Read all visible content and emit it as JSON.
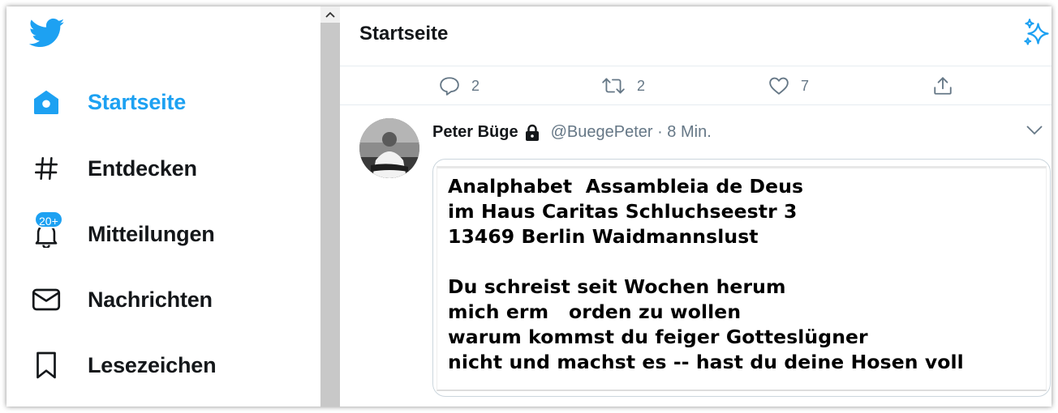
{
  "sidebar": {
    "items": [
      {
        "label": "Startseite",
        "icon": "home-icon",
        "active": true
      },
      {
        "label": "Entdecken",
        "icon": "hashtag-icon"
      },
      {
        "label": "Mitteilungen",
        "icon": "bell-icon",
        "badge": "20+"
      },
      {
        "label": "Nachrichten",
        "icon": "envelope-icon"
      },
      {
        "label": "Lesezeichen",
        "icon": "bookmark-icon"
      }
    ]
  },
  "header": {
    "title": "Startseite"
  },
  "prev_tweet_actions": {
    "reply_count": "2",
    "retweet_count": "2",
    "like_count": "7"
  },
  "tweet": {
    "author": "Peter Büge",
    "handle": "@BuegePeter · 8 Min.",
    "media_lines": [
      "Analphabet  Assambleia de Deus",
      "im Haus Caritas Schluchseestr 3",
      "13469 Berlin Waidmannslust",
      "",
      "Du schreist seit Wochen herum",
      "mich erm   orden zu wollen",
      "warum kommst du feiger Gotteslügner",
      "nicht und machst es -- hast du deine Hosen voll"
    ]
  },
  "colors": {
    "accent": "#1da1f2",
    "muted": "#657786",
    "text": "#14171a"
  }
}
